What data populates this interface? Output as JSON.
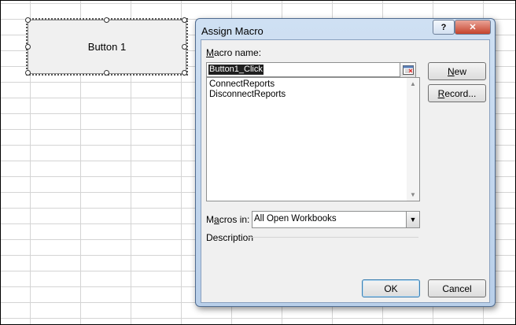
{
  "sheet": {
    "button_label": "Button 1"
  },
  "dialog": {
    "title": "Assign Macro",
    "help_glyph": "?",
    "close_glyph": "✕",
    "macro_name_label_prefix": "",
    "macro_name_label_u": "M",
    "macro_name_label_rest": "acro name:",
    "macro_name_value": "Button1_Click",
    "macro_list": [
      "ConnectReports",
      "DisconnectReports"
    ],
    "macros_in_label_prefix": "M",
    "macros_in_label_u": "a",
    "macros_in_label_rest": "cros in:",
    "macros_in_value": "All Open Workbooks",
    "description_label": "Description",
    "buttons": {
      "new_u": "N",
      "new_rest": "ew",
      "record_u": "R",
      "record_rest": "ecord...",
      "ok": "OK",
      "cancel": "Cancel"
    }
  }
}
